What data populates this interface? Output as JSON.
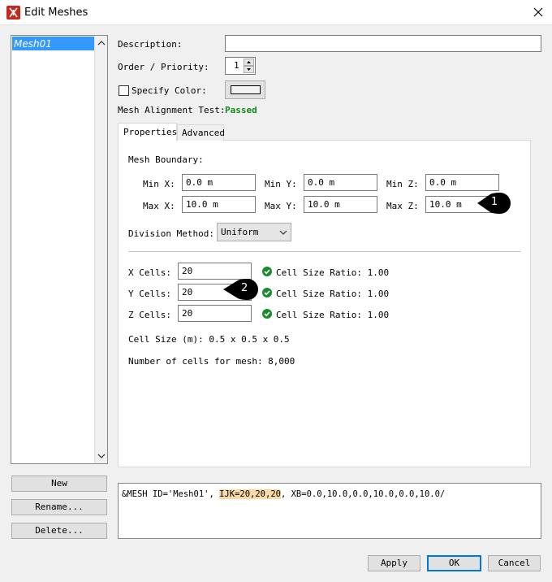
{
  "window": {
    "title": "Edit Meshes",
    "app_icon": "fds-flame-icon"
  },
  "mesh_list": {
    "items": [
      "Mesh01"
    ]
  },
  "left_buttons": {
    "new": "New",
    "rename": "Rename...",
    "delete": "Delete..."
  },
  "form": {
    "description_label": "Description:",
    "description_value": "",
    "priority_label": "Order / Priority:",
    "priority_value": "1",
    "specify_color_label": "Specify Color:",
    "specify_color_checked": false,
    "color_swatch": "#f2f2f2",
    "alignment_label": "Mesh Alignment Test:",
    "alignment_value": "Passed",
    "alignment_color": "#0e8a16"
  },
  "tabs": [
    {
      "label": "Properties",
      "active": true
    },
    {
      "label": "Advanced",
      "active": false
    }
  ],
  "properties": {
    "boundary_label": "Mesh Boundary:",
    "min_x_label": "Min X:",
    "min_x": "0.0 m",
    "min_y_label": "Min Y:",
    "min_y": "0.0 m",
    "min_z_label": "Min Z:",
    "min_z": "0.0 m",
    "max_x_label": "Max X:",
    "max_x": "10.0 m",
    "max_y_label": "Max Y:",
    "max_y": "10.0 m",
    "max_z_label": "Max Z:",
    "max_z": "10.0 m",
    "division_label": "Division Method:",
    "division_value": "Uniform",
    "x_cells_label": "X Cells:",
    "x_cells": "20",
    "y_cells_label": "Y Cells:",
    "y_cells": "20",
    "z_cells_label": "Z Cells:",
    "z_cells": "20",
    "x_ratio": "Cell Size Ratio: 1.00",
    "y_ratio": "Cell Size Ratio: 1.00",
    "z_ratio": "Cell Size Ratio: 1.00",
    "cell_size": "Cell Size (m): 0.5 x 0.5 x 0.5",
    "num_cells": "Number of cells for mesh: 8,000"
  },
  "callouts": [
    "1",
    "2"
  ],
  "namelist": {
    "prefix": "&MESH ID='Mesh01', ",
    "ijk": "IJK=20,20,20",
    "suffix": ", XB=0.0,10.0,0.0,10.0,0.0,10.0/"
  },
  "bottom_buttons": {
    "apply": "Apply",
    "ok": "OK",
    "cancel": "Cancel"
  }
}
